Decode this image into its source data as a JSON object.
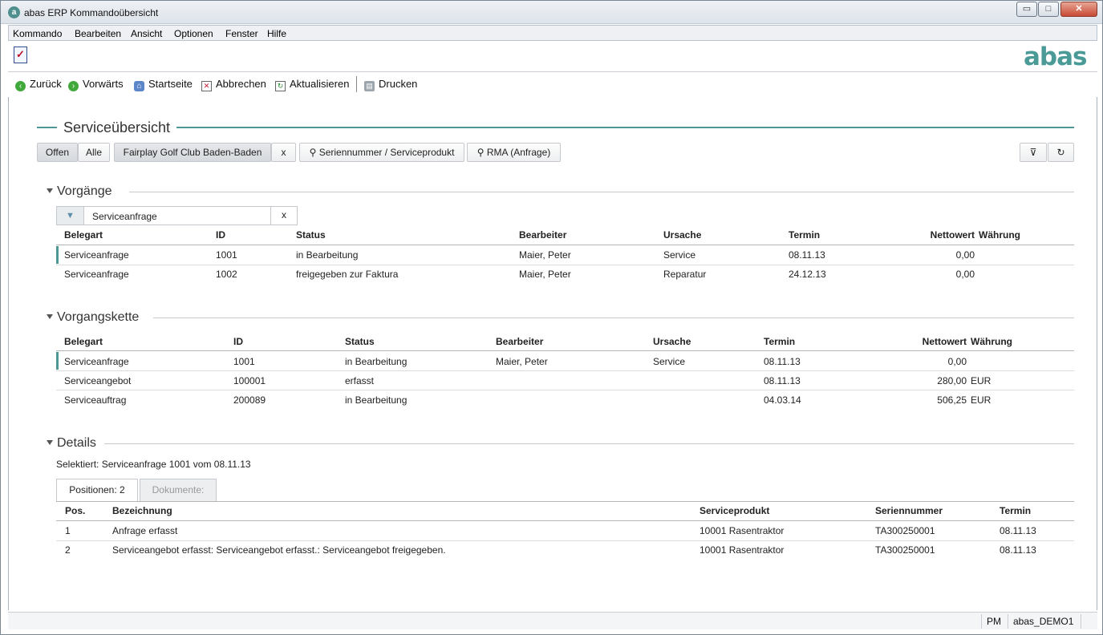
{
  "window": {
    "title": "abas ERP Kommandoübersicht",
    "min": "▭",
    "max": "□",
    "close": "✕"
  },
  "menu": [
    "Kommando",
    "Bearbeiten",
    "Ansicht",
    "Optionen",
    "Fenster",
    "Hilfe"
  ],
  "logo": "abas",
  "toolbar": {
    "back": "Zurück",
    "forward": "Vorwärts",
    "home": "Startseite",
    "cancel": "Abbrechen",
    "refresh": "Aktualisieren",
    "print": "Drucken"
  },
  "page_title": "Serviceübersicht",
  "filters": {
    "open": "Offen",
    "all": "Alle",
    "customer": "Fairplay Golf Club Baden-Baden",
    "customer_clear": "x",
    "serial": "Seriennummer / Serviceprodukt",
    "rma": "RMA (Anfrage)"
  },
  "vorgaenge": {
    "title": "Vorgänge",
    "filter_value": "Serviceanfrage",
    "filter_clear": "x",
    "columns": [
      "Belegart",
      "ID",
      "Status",
      "Bearbeiter",
      "Ursache",
      "Termin",
      "Nettowert",
      "Währung"
    ],
    "rows": [
      [
        "Serviceanfrage",
        "1001",
        "in Bearbeitung",
        "Maier, Peter",
        "Service",
        "08.11.13",
        "0,00",
        ""
      ],
      [
        "Serviceanfrage",
        "1002",
        "freigegeben zur Faktura",
        "Maier, Peter",
        "Reparatur",
        "24.12.13",
        "0,00",
        ""
      ]
    ]
  },
  "vorgangskette": {
    "title": "Vorgangskette",
    "columns": [
      "Belegart",
      "ID",
      "Status",
      "Bearbeiter",
      "Ursache",
      "Termin",
      "Nettowert",
      "Währung"
    ],
    "rows": [
      [
        "Serviceanfrage",
        "1001",
        "in Bearbeitung",
        "Maier, Peter",
        "Service",
        "08.11.13",
        "0,00",
        ""
      ],
      [
        "Serviceangebot",
        "100001",
        "erfasst",
        "",
        "",
        "08.11.13",
        "280,00",
        "EUR"
      ],
      [
        "Serviceauftrag",
        "200089",
        "in Bearbeitung",
        "",
        "",
        "04.03.14",
        "506,25",
        "EUR"
      ]
    ]
  },
  "details": {
    "title": "Details",
    "selected": "Selektiert: Serviceanfrage 1001 vom 08.11.13",
    "tabs": [
      "Positionen: 2",
      "Dokumente:"
    ],
    "columns": [
      "Pos.",
      "Bezeichnung",
      "Serviceprodukt",
      "Seriennummer",
      "Termin"
    ],
    "rows": [
      [
        "1",
        "Anfrage erfasst",
        "10001 Rasentraktor",
        "TA300250001",
        "08.11.13"
      ],
      [
        "2",
        "Serviceangebot erfasst: Serviceangebot erfasst.: Serviceangebot freigegeben.",
        "10001 Rasentraktor",
        "TA300250001",
        "08.11.13"
      ]
    ]
  },
  "status": {
    "user": "PM",
    "client": "abas_DEMO1"
  }
}
